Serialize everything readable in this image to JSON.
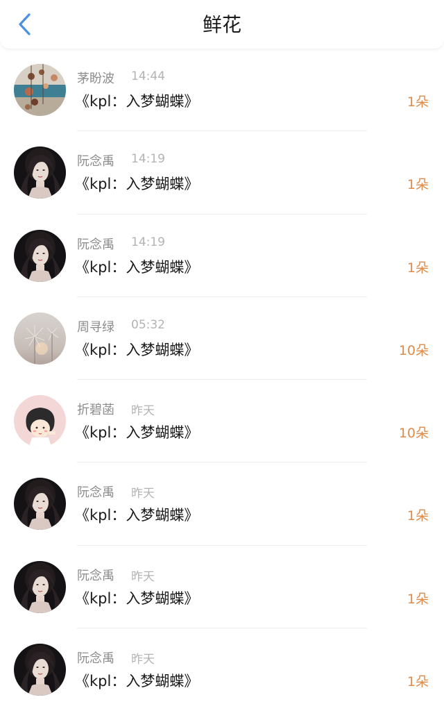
{
  "header": {
    "title": "鲜花",
    "back_icon": "chevron-left-icon",
    "accent_color": "#4a90e2"
  },
  "colors": {
    "count": "#dd8b4a",
    "sender": "#8c8c8c",
    "time": "#b3b3b3"
  },
  "items": [
    {
      "sender": "茅盼波",
      "time": "14:44",
      "title": "《kpl：入梦蝴蝶》",
      "count": "1朵",
      "avatar": "beach-decor"
    },
    {
      "sender": "阮念禹",
      "time": "14:19",
      "title": "《kpl：入梦蝴蝶》",
      "count": "1朵",
      "avatar": "girl-portrait"
    },
    {
      "sender": "阮念禹",
      "time": "14:19",
      "title": "《kpl：入梦蝴蝶》",
      "count": "1朵",
      "avatar": "girl-portrait"
    },
    {
      "sender": "周寻绿",
      "time": "05:32",
      "title": "《kpl：入梦蝴蝶》",
      "count": "10朵",
      "avatar": "dandelion"
    },
    {
      "sender": "折碧菡",
      "time": "昨天",
      "title": "《kpl：入梦蝴蝶》",
      "count": "10朵",
      "avatar": "cartoon-girl"
    },
    {
      "sender": "阮念禹",
      "time": "昨天",
      "title": "《kpl：入梦蝴蝶》",
      "count": "1朵",
      "avatar": "girl-portrait"
    },
    {
      "sender": "阮念禹",
      "time": "昨天",
      "title": "《kpl：入梦蝴蝶》",
      "count": "1朵",
      "avatar": "girl-portrait"
    },
    {
      "sender": "阮念禹",
      "time": "昨天",
      "title": "《kpl：入梦蝴蝶》",
      "count": "1朵",
      "avatar": "girl-portrait"
    }
  ]
}
